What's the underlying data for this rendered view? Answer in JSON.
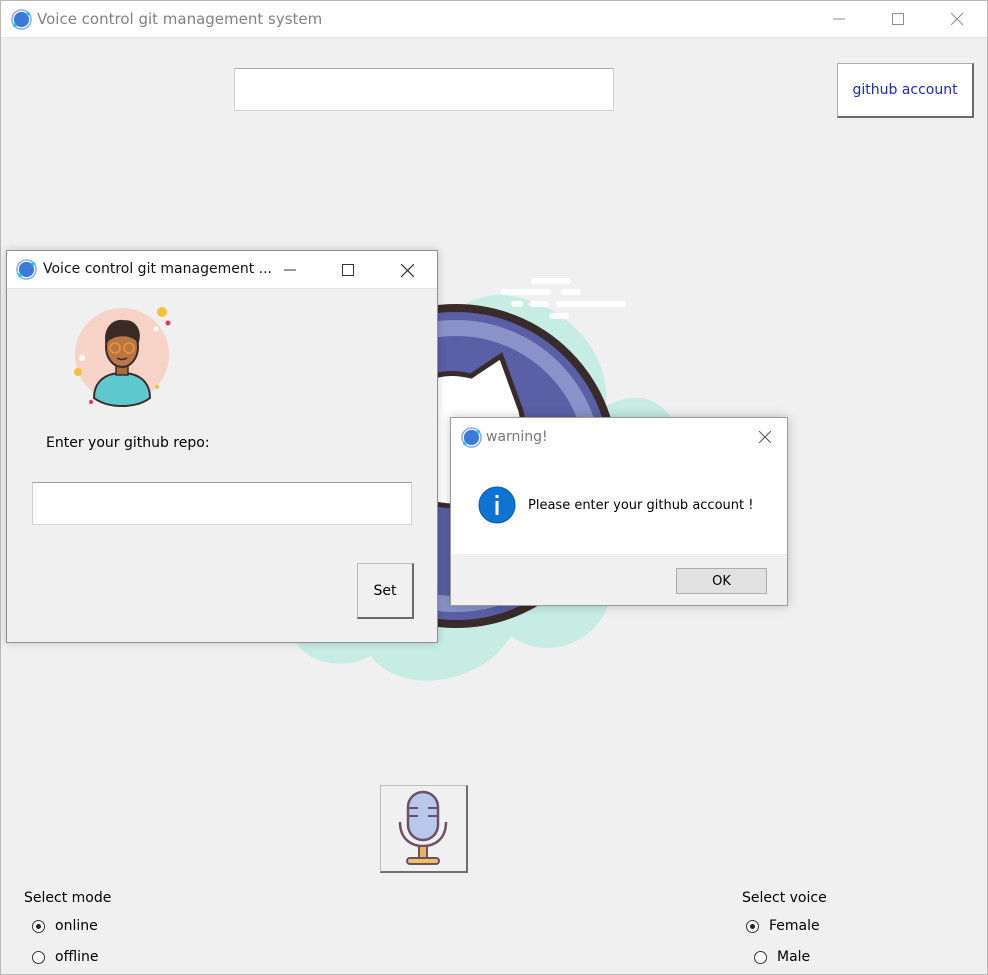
{
  "main_window": {
    "title": "Voice control git management system",
    "github_account_label": "github account",
    "mode": {
      "label": "Select mode",
      "options": [
        "online",
        "offline"
      ],
      "selected": "online"
    },
    "voice": {
      "label": "Select voice",
      "options": [
        "Female",
        "Male"
      ],
      "selected": "Female"
    }
  },
  "repo_window": {
    "title": "Voice control git management ...",
    "prompt": "Enter your github repo:",
    "set_label": "Set"
  },
  "warning_dialog": {
    "title": "warning!",
    "message": "Please enter your github account !",
    "ok_label": "OK"
  },
  "icons": {
    "app": "app-logo-icon",
    "minimize": "minimize-icon",
    "maximize": "maximize-icon",
    "close": "close-icon",
    "info": "info-icon",
    "microphone": "microphone-icon",
    "avatar": "user-avatar-icon"
  },
  "colors": {
    "link_blue": "#1a29c8",
    "cloud": "#c6ece4",
    "octocat_ring": "#5a5fa6",
    "info_blue": "#0f73d3"
  }
}
